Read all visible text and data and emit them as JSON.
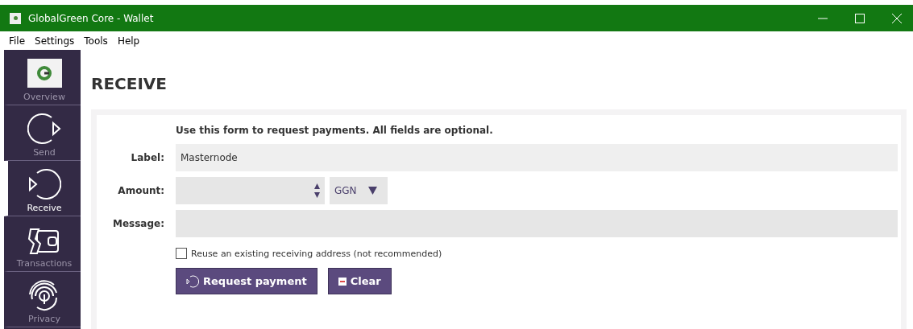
{
  "window": {
    "title": "GlobalGreen Core - Wallet"
  },
  "menu": [
    "File",
    "Settings",
    "Tools",
    "Help"
  ],
  "sidebar": {
    "items": [
      {
        "label": "Overview",
        "kind": "logo",
        "selected": false
      },
      {
        "label": "Send",
        "kind": "send",
        "selected": false
      },
      {
        "label": "Receive",
        "kind": "receive",
        "selected": true
      },
      {
        "label": "Transactions",
        "kind": "transactions",
        "selected": false
      },
      {
        "label": "Privacy",
        "kind": "privacy",
        "selected": false
      }
    ]
  },
  "page": {
    "title": "RECEIVE",
    "intro": "Use this form to request payments. All fields are optional.",
    "label": {
      "caption": "Label:",
      "value": "Masternode"
    },
    "amount": {
      "caption": "Amount:",
      "unit": "GGN"
    },
    "message": {
      "caption": "Message:"
    },
    "reuse": {
      "label": "Reuse an existing receiving address (not recommended)",
      "checked": false
    },
    "buttons": [
      {
        "label": "Request payment",
        "kind": "request"
      },
      {
        "label": "Clear",
        "kind": "clear"
      }
    ]
  }
}
